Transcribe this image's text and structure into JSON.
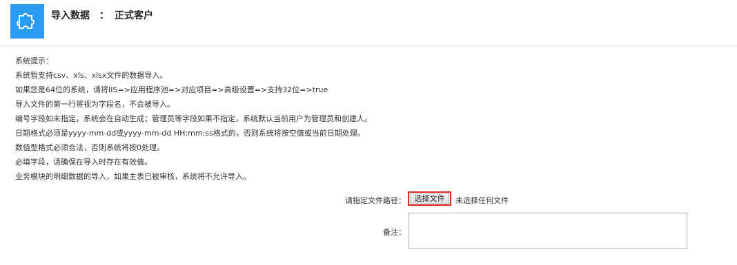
{
  "header": {
    "title": "导入数据",
    "separator": "：",
    "subtitle": "正式客户",
    "icon": "puzzle-icon",
    "accent_color": "#2b9cf1"
  },
  "notice": {
    "heading": "系统提示：",
    "lines": [
      "系统暂支持csv、xls、xlsx文件的数据导入。",
      "如果您是64位的系统，请将IIS=>应用程序池=>对应项目=>高级设置=>支持32位=>true",
      "导入文件的第一行将视为字段名，不会被导入。",
      "编号字段如未指定，系统会在自动生成；管理员等字段如果不指定，系统默认当前用户为管理员和创建人。",
      "日期格式必须是yyyy-mm-dd或yyyy-mm-dd HH:mm:ss格式的，否则系统将按空值或当前日期处理。",
      "数值型格式必须合法，否则系统将按0处理。",
      "必填字段，请确保在导入时存在有效值。",
      "业务模块的明细数据的导入，如果主表已被审核，系统将不允许导入。"
    ]
  },
  "form": {
    "file_label": "请指定文件路径：",
    "file_button": "选择文件",
    "file_status": "未选择任何文件",
    "remark_label": "备注：",
    "remark_value": "",
    "highlight_color": "#e0322b"
  }
}
